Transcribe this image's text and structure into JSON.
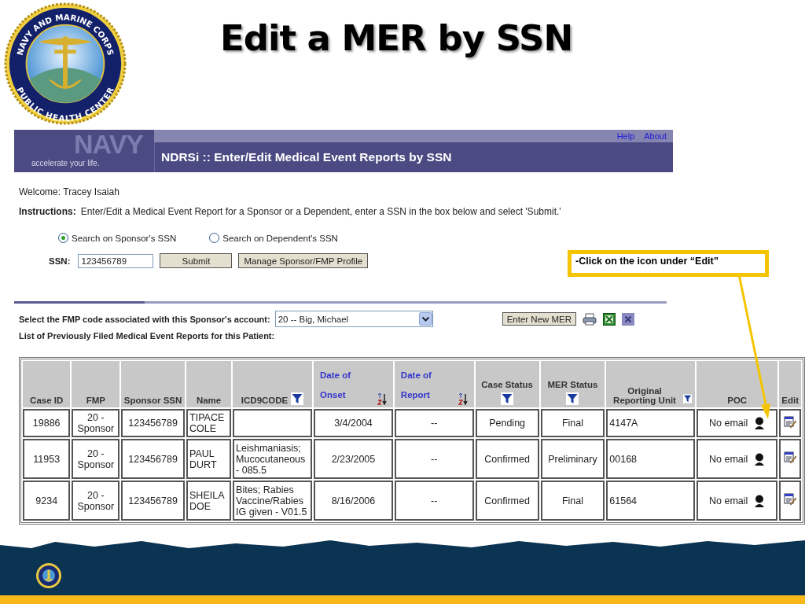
{
  "slide": {
    "title": "Edit a MER by SSN",
    "seal_top_text": "NAVY AND MARINE CORPS",
    "seal_bottom_text": "PUBLIC HEALTH CENTER"
  },
  "banner": {
    "logo_word": "NAVY",
    "tagline": "accelerate your life.",
    "title": "NDRSi :: Enter/Edit Medical Event Reports by SSN",
    "links": [
      "Help",
      "About"
    ]
  },
  "welcome": "Welcome: Tracey Isaiah",
  "instructions": {
    "label": "Instructions:",
    "text": "Enter/Edit a Medical Event Report for a Sponsor or a Dependent, enter a SSN in the box below and select 'Submit.'"
  },
  "search_options": [
    {
      "label": "Search on Sponsor's SSN",
      "selected": true
    },
    {
      "label": "Search on Dependent's SSN",
      "selected": false
    }
  ],
  "ssn": {
    "label": "SSN:",
    "value": "123456789"
  },
  "buttons": [
    "Submit",
    "Manage Sponsor/FMP Profile"
  ],
  "fmp": {
    "label": "Select the FMP code associated with this Sponsor's account:",
    "value": "20 -- Big, Michael",
    "button": "Enter New MER"
  },
  "list_label": "List of Previously Filed Medical Event Reports for this Patient:",
  "table": {
    "columns": [
      {
        "label": "Case ID",
        "kind": "text",
        "filter": false
      },
      {
        "label": "FMP",
        "kind": "text",
        "filter": false
      },
      {
        "label": "Sponsor SSN",
        "kind": "text",
        "filter": false
      },
      {
        "label": "Name",
        "kind": "text",
        "filter": false
      },
      {
        "label": "ICD9CODE",
        "kind": "text",
        "filter": true
      },
      {
        "label": "Date of Onset",
        "kind": "sort",
        "filter": false
      },
      {
        "label": "Date of Report",
        "kind": "sort",
        "filter": false
      },
      {
        "label": "Case Status",
        "kind": "text",
        "filter": true
      },
      {
        "label": "MER Status",
        "kind": "text",
        "filter": true
      },
      {
        "label": "Original Reporting Unit",
        "kind": "text",
        "filter": true
      },
      {
        "label": "POC",
        "kind": "poc",
        "filter": false
      },
      {
        "label": "Edit",
        "kind": "edit",
        "filter": false
      }
    ],
    "rows": [
      [
        "19886",
        "20 - Sponsor",
        "123456789",
        "TIPACE COLE",
        "",
        "3/4/2004",
        "--",
        "Pending",
        "Final",
        "4147A",
        "No email",
        ""
      ],
      [
        "11953",
        "20 - Sponsor",
        "123456789",
        "PAUL DURT",
        "Leishmaniasis; Mucocutaneous - 085.5",
        "2/23/2005",
        "--",
        "Confirmed",
        "Preliminary",
        "00168",
        "No email",
        ""
      ],
      [
        "9234",
        "20 - Sponsor",
        "123456789",
        "SHEILA DOE",
        "Bites; Rabies Vaccine/Rabies IG given - V01.5",
        "8/16/2006",
        "--",
        "Confirmed",
        "Final",
        "61564",
        "No email",
        ""
      ]
    ]
  },
  "callout": "-Click on the icon under “Edit”"
}
